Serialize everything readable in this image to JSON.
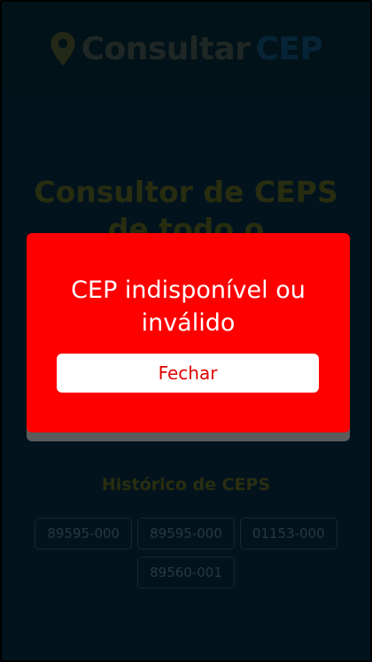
{
  "header": {
    "brand_main": "Consultar",
    "brand_accent": "CEP"
  },
  "hero": {
    "title": "Consultor de CEPS de todo o"
  },
  "history": {
    "title": "Histórico de CEPS",
    "items": [
      "89595-000",
      "89595-000",
      "01153-000",
      "89560-001"
    ]
  },
  "modal": {
    "message": "CEP indisponível ou inválido",
    "close_label": "Fechar"
  },
  "colors": {
    "modal_bg": "#fe0000",
    "accent_blue": "#0d3a57",
    "title_olive": "#4a4a10"
  },
  "icons": {
    "logo": "map-pin-icon"
  }
}
